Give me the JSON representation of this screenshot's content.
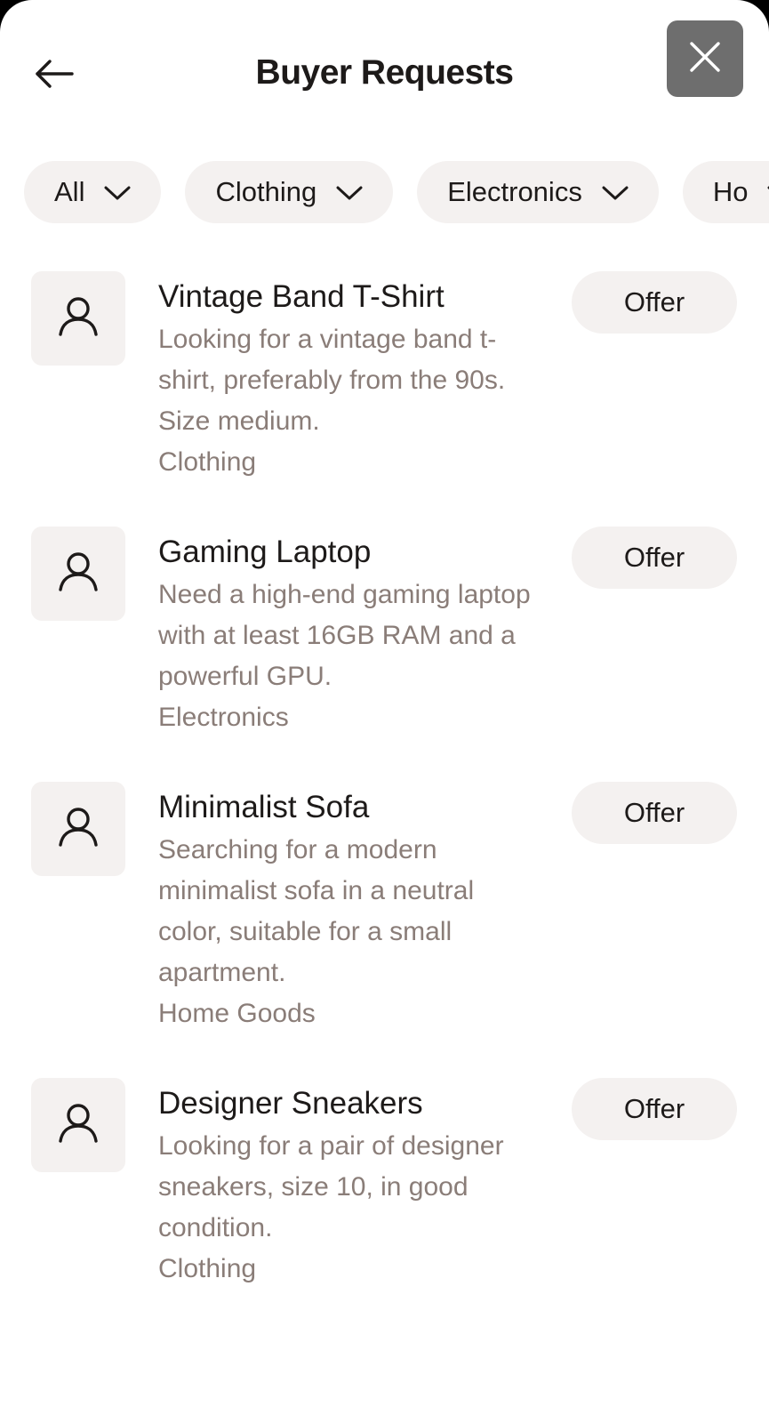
{
  "header": {
    "title": "Buyer Requests"
  },
  "filters": [
    {
      "label": "All"
    },
    {
      "label": "Clothing"
    },
    {
      "label": "Electronics"
    },
    {
      "label": "Ho"
    }
  ],
  "requests": [
    {
      "title": "Vintage Band T-Shirt",
      "description": "Looking for a vintage band t-shirt, preferably from the 90s. Size medium.",
      "category": "Clothing",
      "action": "Offer"
    },
    {
      "title": "Gaming Laptop",
      "description": "Need a high-end gaming laptop with at least 16GB RAM and a powerful GPU.",
      "category": "Electronics",
      "action": "Offer"
    },
    {
      "title": "Minimalist Sofa",
      "description": "Searching for a modern minimalist sofa in a neutral color, suitable for a small apartment.",
      "category": "Home Goods",
      "action": "Offer"
    },
    {
      "title": "Designer Sneakers",
      "description": "Looking for a pair of designer sneakers, size 10, in good condition.",
      "category": "Clothing",
      "action": "Offer"
    }
  ],
  "colors": {
    "text_primary": "#1d1a19",
    "text_secondary": "#8a7d78",
    "chip_bg": "#f4f1f0",
    "close_bg": "#6e6e6e"
  }
}
